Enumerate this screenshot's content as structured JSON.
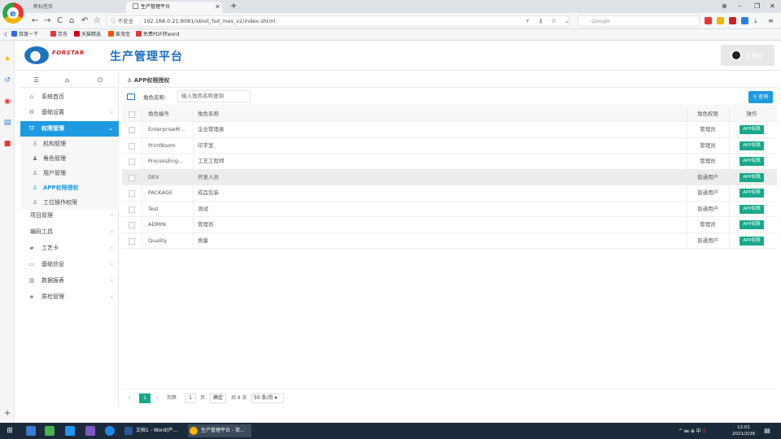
{
  "browser": {
    "tabs": [
      {
        "label": "新标签页"
      },
      {
        "label": "生产管理平台"
      }
    ],
    "nav": {
      "back": "←",
      "forward": "→",
      "reload": "C",
      "home": "⌂",
      "history": "↶",
      "star": "☆"
    },
    "address": {
      "security": "不安全",
      "url": "192.168.0.21:8081/xbiot_fsd_mes_v2/index.shtml"
    },
    "search_placeholder": "Google",
    "window": {
      "pin": "⊕",
      "min": "–",
      "max": "❐",
      "close": "✕"
    },
    "bookmarks": [
      {
        "label": "百度一下",
        "color": "#2d6cdf"
      },
      {
        "label": "京东",
        "color": "#e4393c"
      },
      {
        "label": "天猫精选",
        "color": "#d0021b"
      },
      {
        "label": "爱淘宝",
        "color": "#ff5000"
      },
      {
        "label": "免费PDF转word",
        "color": "#e03a3a"
      }
    ]
  },
  "app": {
    "brand": "FORSTAR",
    "brand_sub": "",
    "title": "生产管理平台",
    "user": "管理员"
  },
  "sidebar": {
    "tools": {
      "menu": "☰",
      "home": "⌂",
      "power": "⏻"
    },
    "items": [
      {
        "label": "系统首页",
        "icon": "⌂"
      },
      {
        "label": "基础设置",
        "icon": "⚙"
      },
      {
        "label": "权限管理",
        "icon": "⛉"
      },
      {
        "label": "项目管理",
        "icon": ""
      },
      {
        "label": "编码工具",
        "icon": ""
      },
      {
        "label": "工艺卡",
        "icon": "▰"
      },
      {
        "label": "基础信息",
        "icon": "▭"
      },
      {
        "label": "数据报表",
        "icon": "▥"
      },
      {
        "label": "质检管理",
        "icon": "◈"
      }
    ],
    "sub_items": [
      {
        "label": "机构管理",
        "icon": "♙"
      },
      {
        "label": "角色管理",
        "icon": "♟"
      },
      {
        "label": "用户管理",
        "icon": "♙"
      },
      {
        "label": "APP权限授权",
        "icon": "♙"
      },
      {
        "label": "工位操作权限",
        "icon": "♙"
      }
    ]
  },
  "page": {
    "breadcrumb": "APP权限授权",
    "filter_label": "角色名称:",
    "filter_placeholder": "输入角色名称查询",
    "search_button": "查询"
  },
  "table": {
    "headers": {
      "code": "角色编号",
      "name": "角色名称",
      "perm": "角色权限",
      "op": "操作"
    },
    "rows": [
      {
        "code": "EnterpriseM...",
        "name": "企业管理者",
        "perm": "管理员",
        "op": "APP权限"
      },
      {
        "code": "PrintRoom",
        "name": "印字室",
        "perm": "管理员",
        "op": "APP权限"
      },
      {
        "code": "ProcessEng...",
        "name": "工艺工程师",
        "perm": "管理员",
        "op": "APP权限"
      },
      {
        "code": "DEV",
        "name": "开发人员",
        "perm": "普通用户",
        "op": "APP权限"
      },
      {
        "code": "PACKAGE",
        "name": "成品包装",
        "perm": "普通用户",
        "op": "APP权限"
      },
      {
        "code": "Test",
        "name": "测试",
        "perm": "普通用户",
        "op": "APP权限"
      },
      {
        "code": "ADMIN",
        "name": "管理员",
        "perm": "管理员",
        "op": "APP权限"
      },
      {
        "code": "Quality",
        "name": "质量",
        "perm": "普通用户",
        "op": "APP权限"
      }
    ]
  },
  "pager": {
    "prev": "‹",
    "current": "1",
    "next": "›",
    "goto_label": "到第",
    "goto_value": "1",
    "page_unit": "页",
    "confirm": "确定",
    "total": "共 8 条",
    "page_size": "50 条/页"
  },
  "taskbar": {
    "apps": [
      {
        "label": "文档1 - Word(产..."
      },
      {
        "label": "生产管理平台 - 双..."
      }
    ],
    "tray": "^ 🖮 ⊕ 中",
    "time": "12:01",
    "date": "2021/2/26"
  }
}
